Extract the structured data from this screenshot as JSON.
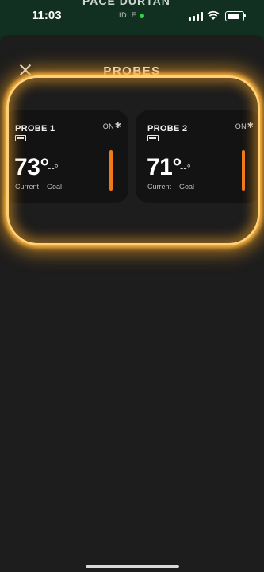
{
  "status_bar": {
    "time": "11:03",
    "state": "IDLE"
  },
  "header": {
    "device_name": "PACE DURTAN",
    "title": "PROBES"
  },
  "probes": [
    {
      "name": "PROBE 1",
      "status": "ON",
      "current": "73°",
      "goal": "--°",
      "current_label": "Current",
      "goal_label": "Goal"
    },
    {
      "name": "PROBE 2",
      "status": "ON",
      "current": "71°",
      "goal": "--°",
      "current_label": "Current",
      "goal_label": "Goal"
    }
  ],
  "colors": {
    "accent": "#f07a18",
    "connected": "#2bd34b",
    "highlight": "#ffb43c"
  }
}
